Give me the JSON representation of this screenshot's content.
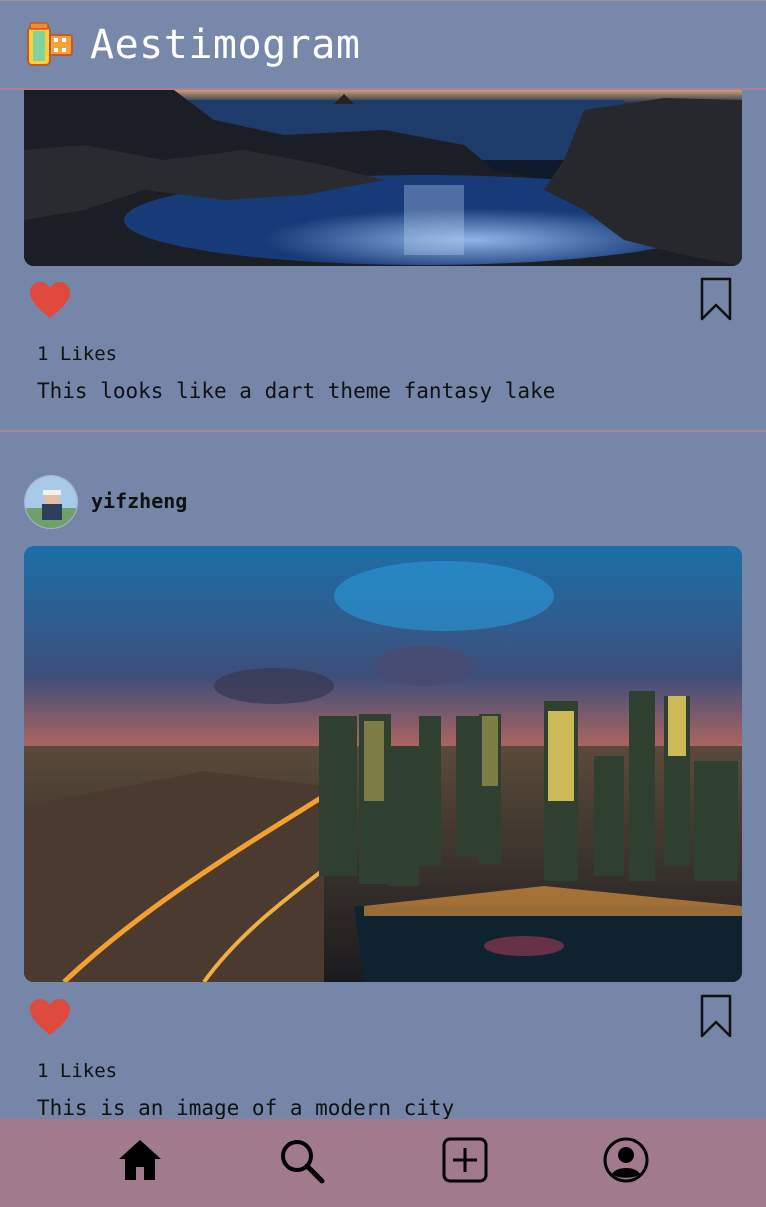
{
  "header": {
    "title": "Aestimogram",
    "logo_icon": "film-roll-icon"
  },
  "posts": [
    {
      "likes_text": "1 Likes",
      "caption": "This looks like a dart theme fantasy lake",
      "liked": true,
      "image_icon": "lake-photo"
    },
    {
      "username": "yifzheng",
      "likes_text": "1 Likes",
      "caption": "This is an image of a modern city",
      "liked": true,
      "image_icon": "city-photo"
    }
  ],
  "nav": {
    "items": [
      "home-icon",
      "search-icon",
      "add-post-icon",
      "profile-icon"
    ]
  },
  "colors": {
    "background": "#7586a8",
    "nav": "#a27a8e",
    "heart": "#e04a3e"
  }
}
